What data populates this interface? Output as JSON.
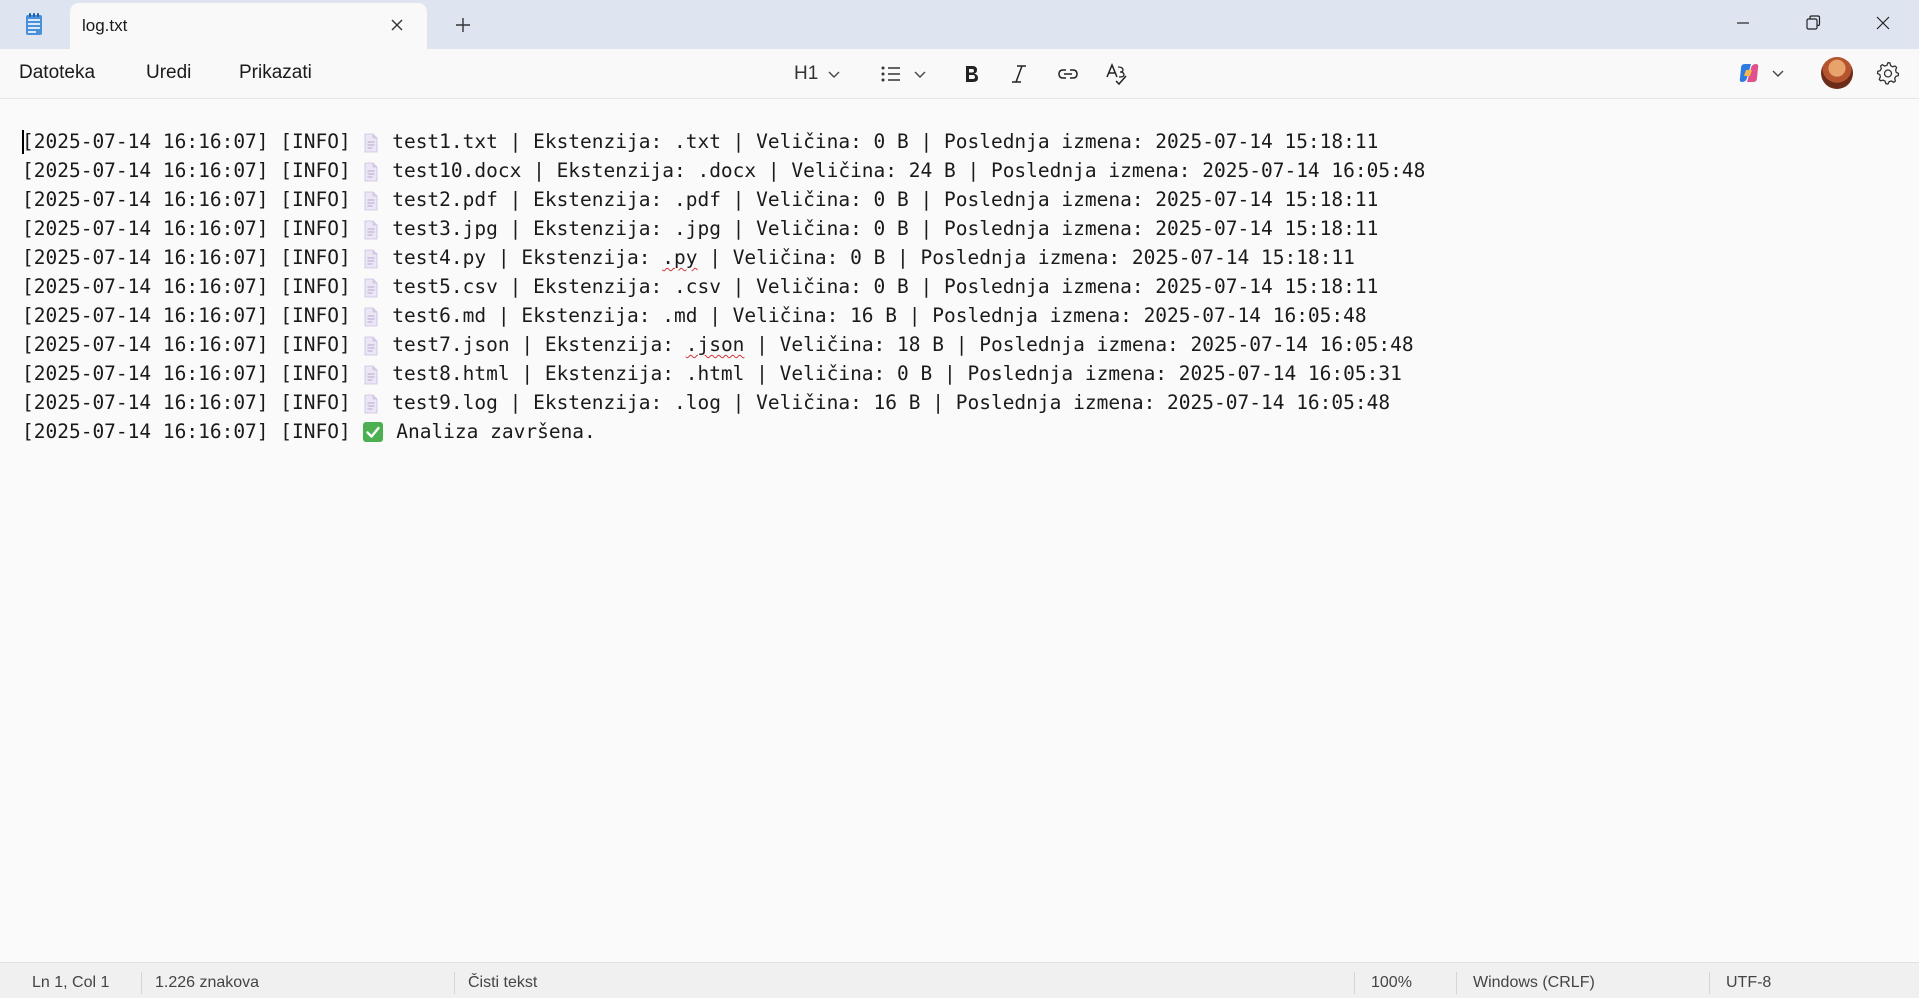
{
  "tab": {
    "title": "log.txt"
  },
  "menu": {
    "file": "Datoteka",
    "edit": "Uredi",
    "view": "Prikazati"
  },
  "toolbar": {
    "heading": "H1"
  },
  "editor": {
    "lines": [
      {
        "prefix": "[2025-07-14 16:16:07] [INFO] ",
        "icon": "document-icon",
        "text": " test1.txt | Ekstenzija: .txt | Veličina: 0 B | Poslednja izmena: 2025-07-14 15:18:11"
      },
      {
        "prefix": "[2025-07-14 16:16:07] [INFO] ",
        "icon": "document-icon",
        "text": " test10.docx | Ekstenzija: .docx | Veličina: 24 B | Poslednja izmena: 2025-07-14 16:05:48"
      },
      {
        "prefix": "[2025-07-14 16:16:07] [INFO] ",
        "icon": "document-icon",
        "text": " test2.pdf | Ekstenzija: .pdf | Veličina: 0 B | Poslednja izmena: 2025-07-14 15:18:11"
      },
      {
        "prefix": "[2025-07-14 16:16:07] [INFO] ",
        "icon": "document-icon",
        "text": " test3.jpg | Ekstenzija: .jpg | Veličina: 0 B | Poslednja izmena: 2025-07-14 15:18:11"
      },
      {
        "prefix": "[2025-07-14 16:16:07] [INFO] ",
        "icon": "document-icon",
        "text": " test4.py | Ekstenzija: ",
        "squiggle": ".py",
        "text2": " | Veličina: 0 B | Poslednja izmena: 2025-07-14 15:18:11"
      },
      {
        "prefix": "[2025-07-14 16:16:07] [INFO] ",
        "icon": "document-icon",
        "text": " test5.csv | Ekstenzija: .csv | Veličina: 0 B | Poslednja izmena: 2025-07-14 15:18:11"
      },
      {
        "prefix": "[2025-07-14 16:16:07] [INFO] ",
        "icon": "document-icon",
        "text": " test6.md | Ekstenzija: .md | Veličina: 16 B | Poslednja izmena: 2025-07-14 16:05:48"
      },
      {
        "prefix": "[2025-07-14 16:16:07] [INFO] ",
        "icon": "document-icon",
        "text": " test7.json | Ekstenzija: ",
        "squiggle": ".json",
        "text2": " | Veličina: 18 B | Poslednja izmena: 2025-07-14 16:05:48"
      },
      {
        "prefix": "[2025-07-14 16:16:07] [INFO] ",
        "icon": "document-icon",
        "text": " test8.html | Ekstenzija: .html | Veličina: 0 B | Poslednja izmena: 2025-07-14 16:05:31"
      },
      {
        "prefix": "[2025-07-14 16:16:07] [INFO] ",
        "icon": "document-icon",
        "text": " test9.log | Ekstenzija: .log | Veličina: 16 B | Poslednja izmena: 2025-07-14 16:05:48"
      },
      {
        "prefix": "[2025-07-14 16:16:07] [INFO] ",
        "icon": "check-mark-icon",
        "text": " Analiza završena."
      }
    ]
  },
  "status": {
    "position": "Ln 1, Col 1",
    "char_count": "1.226 znakova",
    "format": "Čisti tekst",
    "zoom": "100%",
    "line_ending": "Windows (CRLF)",
    "encoding": "UTF-8"
  },
  "colors": {
    "titlebar_bg": "#dfe5f0",
    "accent": "#0067c0",
    "check_green": "#4caf50"
  }
}
